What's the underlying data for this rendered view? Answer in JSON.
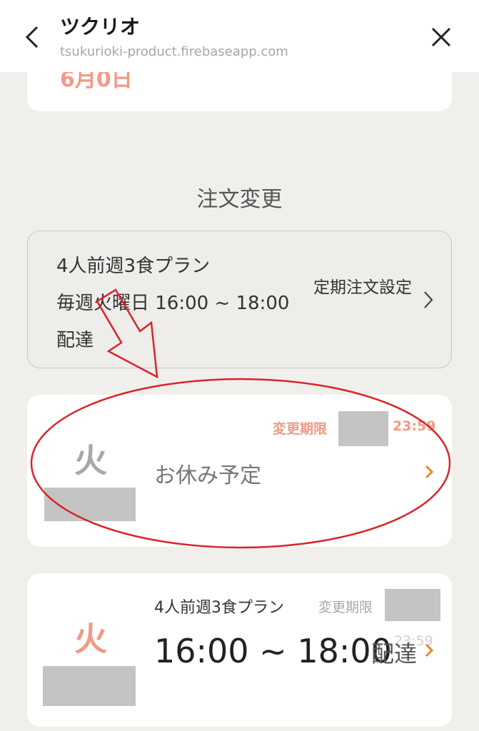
{
  "topbar": {
    "title": "ツクリオ",
    "url": "tsukurioki-product.firebaseapp.com",
    "back_icon": "chevron-left-icon",
    "close_icon": "close-icon"
  },
  "previous_card": {
    "text": "6月0日"
  },
  "section_title": "注文変更",
  "plan": {
    "name": "4人前週3食プラン",
    "schedule": "毎週火曜日 16:00 ~ 18:00",
    "delivery": "配達",
    "settings_label": "定期注文設定",
    "chevron_icon": "chevron-right-icon"
  },
  "orders": [
    {
      "day": "火",
      "deadline_label": "変更期限",
      "deadline_time": "23:59",
      "status": "お休み予定",
      "chevron_icon": "chevron-right-icon"
    },
    {
      "day": "火",
      "plan_name": "4人前週3食プラン",
      "deadline_label": "変更期限",
      "deadline_time": "23:59",
      "time_range": "16:00 ~ 18:00",
      "delivery": "配達",
      "chevron_icon": "chevron-right-icon"
    }
  ],
  "colors": {
    "accent_salmon": "#f19a86",
    "chevron_orange": "#e8872c",
    "annotation_red": "#d8242a",
    "background": "#f1efec"
  }
}
